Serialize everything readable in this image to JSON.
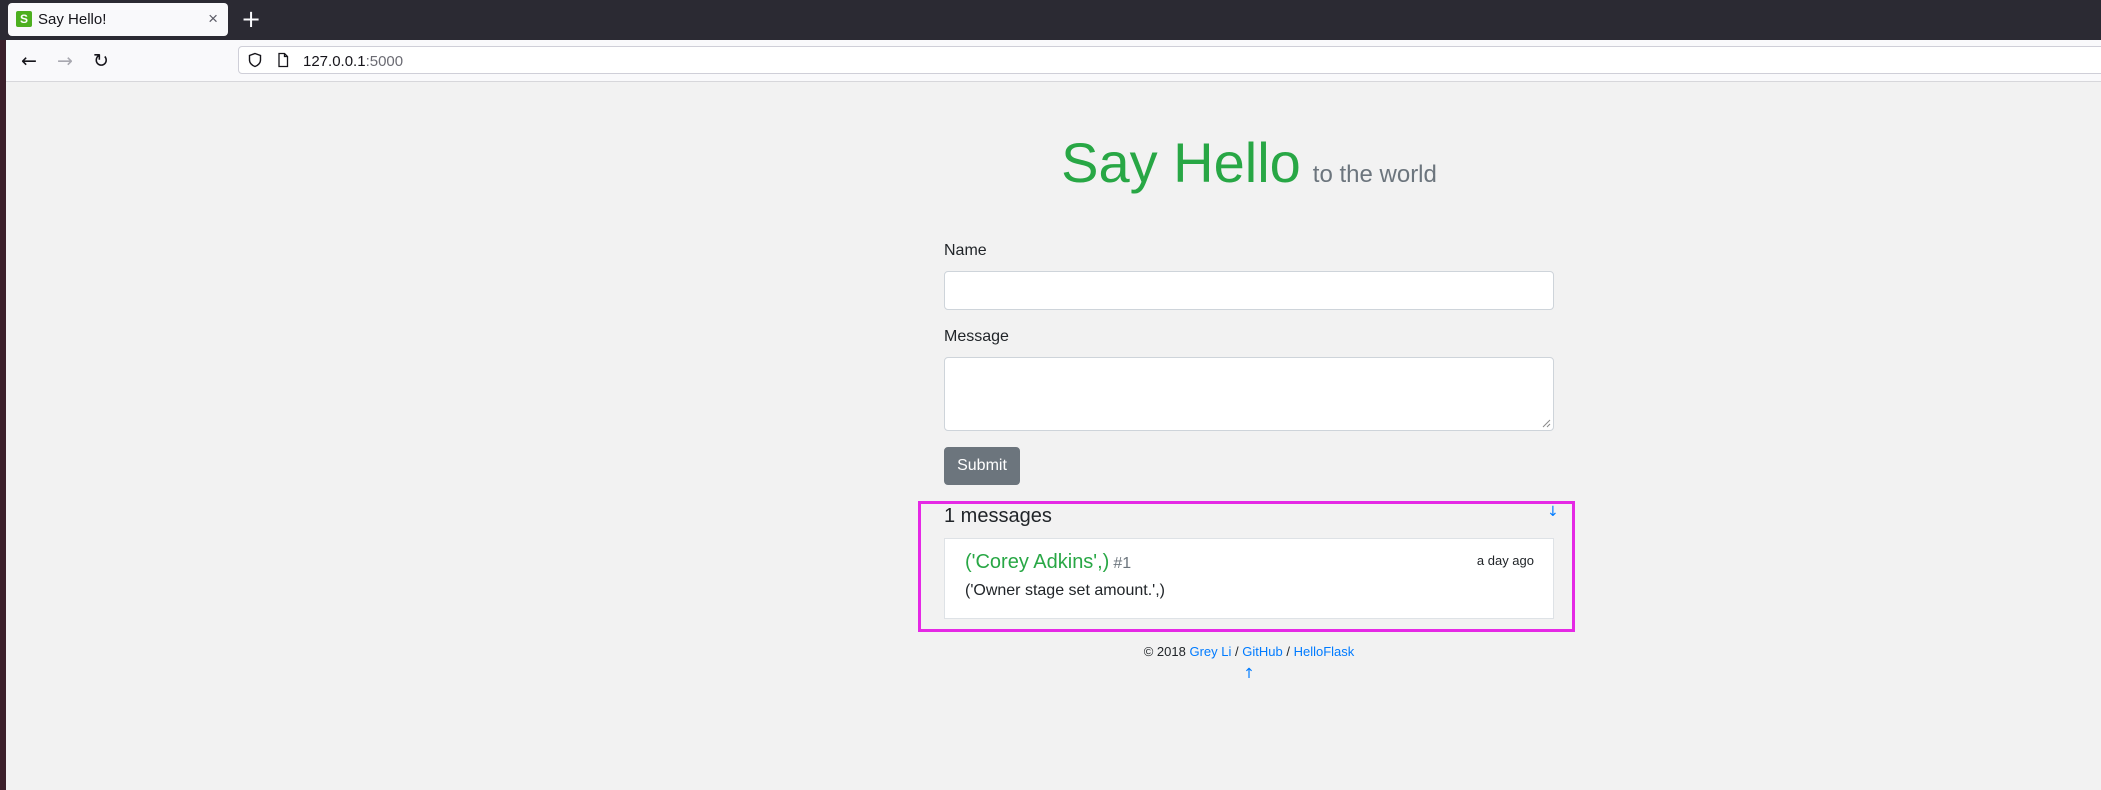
{
  "browser": {
    "tab": {
      "favicon_letter": "S",
      "title": "Say Hello!",
      "close_glyph": "×"
    },
    "new_tab_glyph": "+",
    "nav": {
      "back_glyph": "←",
      "forward_glyph": "→",
      "reload_glyph": "↻"
    },
    "url": {
      "host": "127.0.0.1",
      "port": ":5000"
    }
  },
  "page": {
    "title": "Say Hello",
    "subtitle": "to the world",
    "form": {
      "name_label": "Name",
      "name_value": "",
      "message_label": "Message",
      "message_value": "",
      "submit_label": "Submit"
    },
    "messages": {
      "count_label": "1 messages",
      "jump_down_glyph": "↓",
      "items": [
        {
          "author": "('Corey Adkins',)",
          "number": "#1",
          "time": "a day ago",
          "body": "('Owner stage set amount.',)"
        }
      ]
    },
    "footer": {
      "copyright": "© 2018",
      "author_link": "Grey Li",
      "sep1": "/",
      "github_link": "GitHub",
      "sep2": "/",
      "helloflask_link": "HelloFlask",
      "jump_up_glyph": "↑"
    }
  },
  "colors": {
    "accent_green": "#28a745",
    "link_blue": "#007bff",
    "highlight_magenta": "#e529e5",
    "button_gray": "#6c757d"
  }
}
